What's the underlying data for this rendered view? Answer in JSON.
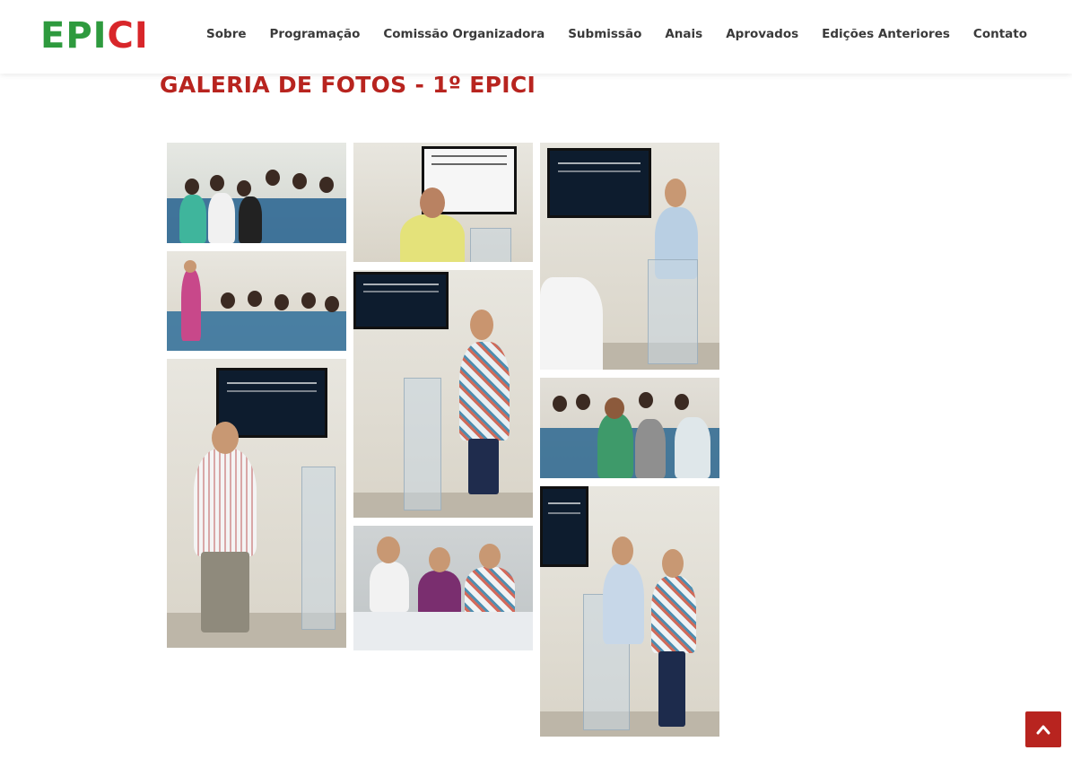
{
  "brand": {
    "letters": [
      {
        "char": "E",
        "color": "#2e9a3e"
      },
      {
        "char": "P",
        "color": "#2e9a3e"
      },
      {
        "char": "I",
        "color": "#2e9a3e"
      },
      {
        "char": "C",
        "color": "#d8262a"
      },
      {
        "char": "I",
        "color": "#d8262a"
      }
    ]
  },
  "nav": {
    "items": [
      {
        "label": "Sobre"
      },
      {
        "label": "Programação"
      },
      {
        "label": "Comissão Organizadora"
      },
      {
        "label": "Submissão"
      },
      {
        "label": "Anais"
      },
      {
        "label": "Aprovados"
      },
      {
        "label": "Edições Anteriores"
      },
      {
        "label": "Contato"
      }
    ]
  },
  "page": {
    "title": "GALERIA DE FOTOS - 1º EPICI"
  },
  "gallery": {
    "photos": [
      {
        "subject": "audience-photo"
      },
      {
        "subject": "speaker-photo"
      },
      {
        "subject": "speaker-photo"
      },
      {
        "subject": "audience-photo"
      },
      {
        "subject": "speaker-photo"
      },
      {
        "subject": "audience-photo"
      },
      {
        "subject": "speaker-photo"
      },
      {
        "subject": "panel-photo"
      },
      {
        "subject": "speakers-photo"
      }
    ]
  },
  "colors": {
    "accent": "#b8241f",
    "nav_text": "#3a3a3a"
  },
  "icons": {
    "scroll_top": "chevron-up-icon"
  }
}
